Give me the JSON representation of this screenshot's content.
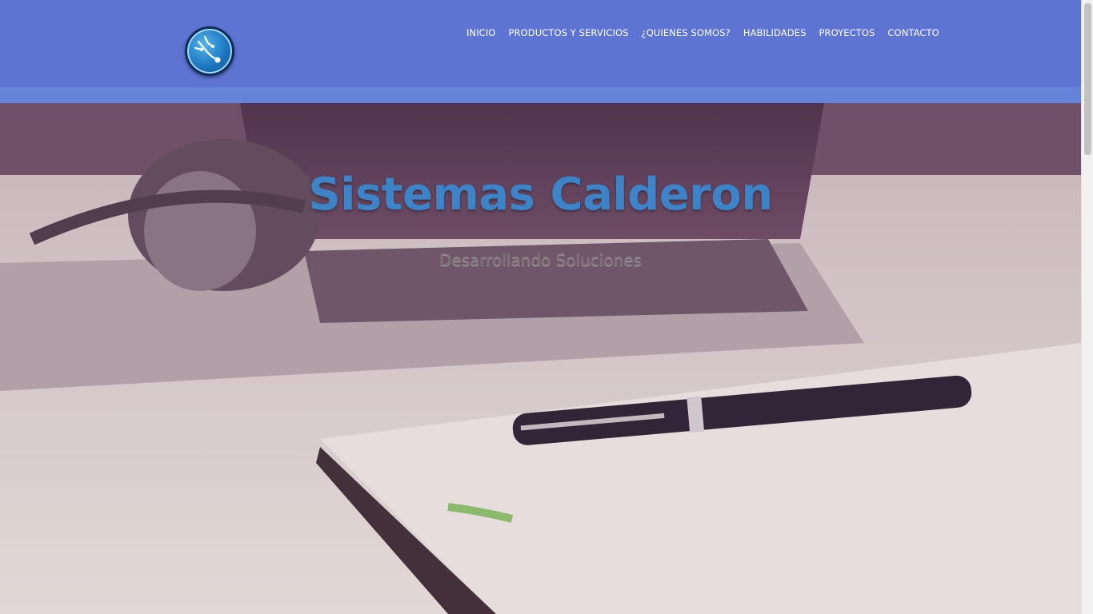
{
  "header": {
    "logo_icon": "circuit-logo-icon",
    "nav": [
      {
        "label": "INICIO"
      },
      {
        "label": "PRODUCTOS Y SERVICIOS"
      },
      {
        "label": "¿QUIENES SOMOS?"
      },
      {
        "label": "HABILIDADES"
      },
      {
        "label": "PROYECTOS"
      },
      {
        "label": "CONTACTO"
      }
    ]
  },
  "hero": {
    "title": "Sistemas Calderon",
    "subtitle": "Desarrollando Soluciones",
    "background_image": "desk with laptop, headphones, pen and notebook"
  },
  "colors": {
    "header_bg": "#5d74d2",
    "subbar_bg": "#6583d8",
    "title_color": "#3d83c8",
    "subtitle_color": "#7a7273"
  }
}
